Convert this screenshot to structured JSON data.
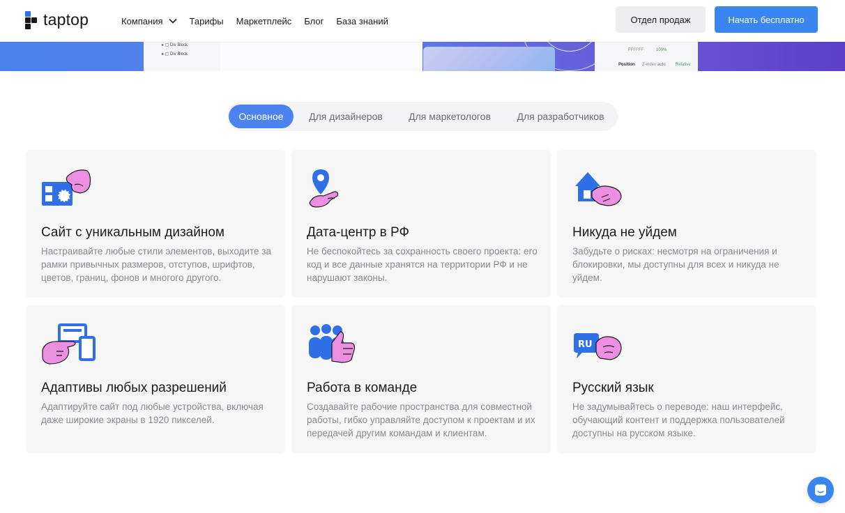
{
  "header": {
    "logo_text": "taptop",
    "nav": [
      {
        "label": "Компания",
        "has_dropdown": true
      },
      {
        "label": "Тарифы"
      },
      {
        "label": "Маркетплейс"
      },
      {
        "label": "Блог"
      },
      {
        "label": "База знаний"
      }
    ],
    "sales_label": "Отдел продаж",
    "start_label": "Начать бесплатно"
  },
  "hero": {
    "layer_rows": [
      "Div Block",
      "Div Block"
    ],
    "panel_value_1": "FFFFFF",
    "panel_value_2": "100%",
    "panel_label": "Position",
    "panel_value_3": "Z-index",
    "panel_value_4": "auto",
    "panel_value_5": "Relative"
  },
  "tabs": [
    {
      "label": "Основное",
      "active": true
    },
    {
      "label": "Для дизайнеров"
    },
    {
      "label": "Для маркетологов"
    },
    {
      "label": "Для разработчиков"
    }
  ],
  "features": [
    {
      "title": "Сайт с уникальным дизайном",
      "description": "Настраивайте любые стили элементов, выходите за рамки привычных размеров, отступов, шрифтов, цветов, границ, фонов и многого другого.",
      "icon": "design-hand-icon"
    },
    {
      "title": "Дата-центр в РФ",
      "description": "Не беспокойтесь за сохранность своего проекта: его код и все данные хранятся на территории РФ и не нарушают законы.",
      "icon": "location-hand-icon"
    },
    {
      "title": "Никуда не уйдем",
      "description": "Забудьте о рисках: несмотря на ограничения и блокировки, мы доступны для всех и никуда не уйдем.",
      "icon": "house-hand-icon"
    },
    {
      "title": "Адаптивы любых разрешений",
      "description": "Адаптируйте сайт под любые устройства, включая даже широкие экраны в 1920 пикселей.",
      "icon": "devices-hand-icon"
    },
    {
      "title": "Работа в команде",
      "description": "Создавайте рабочие пространства для совместной работы, гибко управляйте доступом к проектам и их передачей другим командам и клиентам.",
      "icon": "team-thumbs-up-icon"
    },
    {
      "title": "Русский язык",
      "description": "Не задумывайтесь о переводе: наш интерфейс, обучающий контент и поддержка пользователей доступны на русском языке.",
      "icon": "ru-speech-hand-icon",
      "badge": "RU"
    }
  ],
  "colors": {
    "accent": "#3a86f0",
    "tab_active": "#4c83ee",
    "icon_blue": "#2f6fe8",
    "icon_pink": "#ec8fe0"
  }
}
